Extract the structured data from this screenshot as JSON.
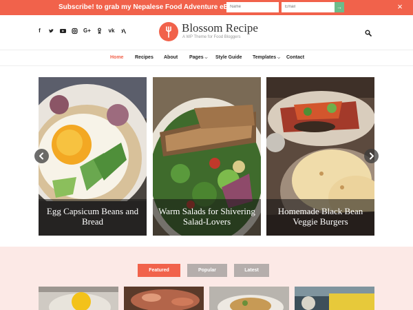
{
  "topbar": {
    "text": "Subscribe! to grab my Nepalese Food Adventure eBook!",
    "name_placeholder": "Name",
    "email_placeholder": "Email",
    "submit_icon": "arrow-right-icon",
    "close_icon": "close-icon"
  },
  "social": [
    "facebook-icon",
    "twitter-icon",
    "youtube-icon",
    "instagram-icon",
    "google-plus-icon",
    "odnoklassniki-icon",
    "vk-icon",
    "xing-icon"
  ],
  "header": {
    "title": "Blossom Recipe",
    "tagline": "A WP Theme for Food Bloggers",
    "search_icon": "search-icon"
  },
  "nav": {
    "items": [
      "Home",
      "Recipes",
      "About",
      "Pages",
      "Style Guide",
      "Templates",
      "Contact"
    ],
    "active": "Home"
  },
  "slider": {
    "slides": [
      {
        "caption": "Egg Capsicum Beans and Bread"
      },
      {
        "caption": "Warm Salads for Shivering Salad-Lovers"
      },
      {
        "caption": "Homemade Black Bean Veggie Burgers"
      }
    ]
  },
  "tabs": [
    "Featured",
    "Popular",
    "Latest"
  ],
  "colors": {
    "accent": "#f1624b",
    "tab_inactive": "#b5aeac",
    "section_bg": "#fce9e6"
  }
}
